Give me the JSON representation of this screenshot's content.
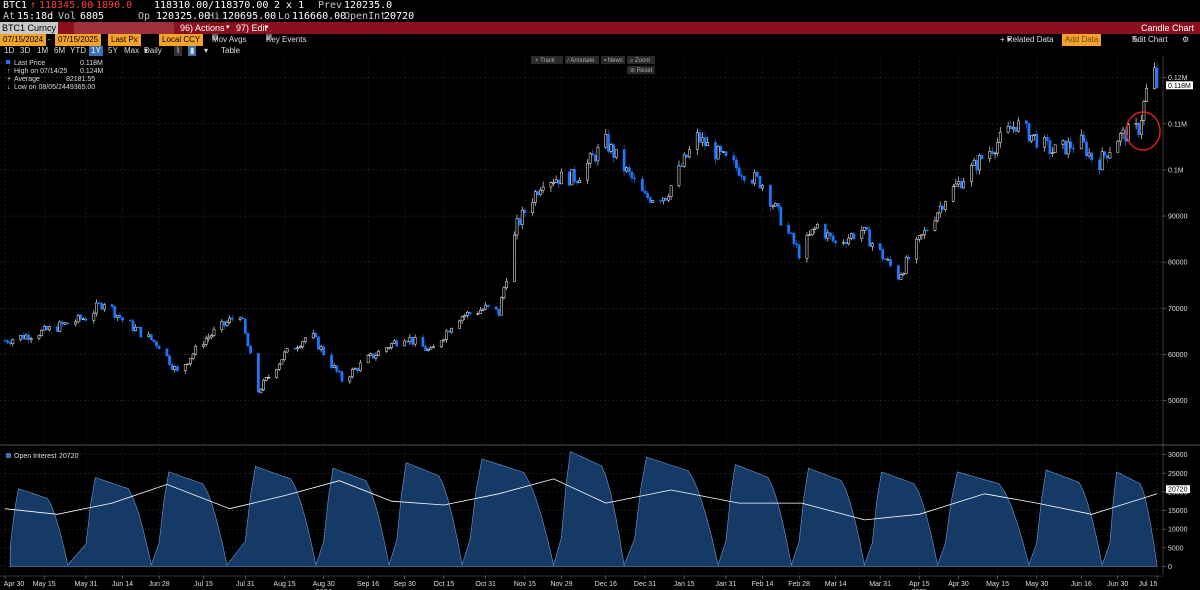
{
  "quote": {
    "ticker": "BTC1",
    "arrow": "↑",
    "last": "118345.00",
    "change": "-1890.0",
    "bid_ask": "118310.00/118370.00",
    "size": "2 x 1",
    "prev_label": "Prev",
    "prev": "120235.0",
    "at_label": "At",
    "time": "15:18d",
    "vol_label": "Vol",
    "vol": "6805",
    "op_label": "Op",
    "open": "120325.00",
    "hi_label": "Hi",
    "high": "120695.00",
    "lo_label": "Lo",
    "low": "116660.00",
    "oi_label": "OpenInt",
    "open_int": "20720"
  },
  "security_bar": {
    "security": "BTC1 Curncy",
    "actions_label": "96) Actions",
    "edit_label": "97) Edit",
    "title": "Candle Chart"
  },
  "toolbar": {
    "start_date": "07/15/2024",
    "end_date": "07/15/2025",
    "field": "Last Px",
    "currency": "Local CCY",
    "mov_avgs": "Mov Avgs",
    "key_events": "Key Events",
    "related_data": "Related Data",
    "add_data": "Add Data",
    "edit_chart": "Edit Chart"
  },
  "periods": {
    "items": [
      "1D",
      "3D",
      "1M",
      "6M",
      "YTD",
      "1Y",
      "5Y",
      "Max"
    ],
    "active": "1Y",
    "freq": "Daily",
    "table": "Table"
  },
  "chart_tools": [
    "Track",
    "Annotate",
    "News",
    "Zoom"
  ],
  "reset_label": "Reset",
  "legend": {
    "last_price_label": "Last Price",
    "last_price": "0.118M",
    "high_label": "High on 07/14/25",
    "high": "0.124M",
    "avg_label": "Average",
    "avg": "82181.55",
    "low_label": "Low on 08/05/24",
    "low": "49365.00",
    "oi_label": "Open Interest",
    "oi_value": "20720"
  },
  "colors": {
    "up": "#ffffff",
    "down": "#1e78ff",
    "oi_fill": "#163a66",
    "oi_line": "#ffffff",
    "annotation": "#e0202a"
  },
  "chart_data": [
    {
      "type": "candlestick",
      "title": "",
      "y_axis_labels": [
        "50000",
        "60000",
        "70000",
        "80000",
        "90000",
        "0.1M",
        "0.11M",
        "0.12M"
      ],
      "ylim": [
        41000,
        124700
      ],
      "x_tick_labels": [
        "Apr 30",
        "May 15",
        "May 31",
        "Jun 14",
        "Jun 28",
        "Jul 15",
        "Jul 31",
        "Aug 15",
        "Aug 30",
        "Sep 16",
        "Sep 30",
        "Oct 15",
        "Oct 31",
        "Nov 15",
        "Nov 29",
        "Dec 16",
        "Dec 31",
        "Jan 15",
        "Jan 31",
        "Feb 14",
        "Feb 28",
        "Mar 14",
        "Mar 31",
        "Apr 15",
        "Apr 30",
        "May 15",
        "May 30",
        "Jun 16",
        "Jun 30",
        "Jul 15"
      ],
      "year_labels": [
        "2024",
        "2025"
      ],
      "last_label": "0.118M",
      "price_path": [
        [
          "2024-04-30",
          63000
        ],
        [
          "2024-05-15",
          65000
        ],
        [
          "2024-05-31",
          68000
        ],
        [
          "2024-06-07",
          71500
        ],
        [
          "2024-06-14",
          67500
        ],
        [
          "2024-06-28",
          62000
        ],
        [
          "2024-07-05",
          56000
        ],
        [
          "2024-07-15",
          63000
        ],
        [
          "2024-07-29",
          69000
        ],
        [
          "2024-08-05",
          52000
        ],
        [
          "2024-08-15",
          60000
        ],
        [
          "2024-08-25",
          64500
        ],
        [
          "2024-09-06",
          54500
        ],
        [
          "2024-09-16",
          59000
        ],
        [
          "2024-09-30",
          64000
        ],
        [
          "2024-10-10",
          60500
        ],
        [
          "2024-10-20",
          68000
        ],
        [
          "2024-10-31",
          70000
        ],
        [
          "2024-11-05",
          69000
        ],
        [
          "2024-11-12",
          88000
        ],
        [
          "2024-11-22",
          98000
        ],
        [
          "2024-12-05",
          98500
        ],
        [
          "2024-12-16",
          106000
        ],
        [
          "2024-12-31",
          94000
        ],
        [
          "2025-01-08",
          94500
        ],
        [
          "2025-01-20",
          107000
        ],
        [
          "2025-01-31",
          102000
        ],
        [
          "2025-02-14",
          97000
        ],
        [
          "2025-02-25",
          85000
        ],
        [
          "2025-02-28",
          82000
        ],
        [
          "2025-03-07",
          88000
        ],
        [
          "2025-03-14",
          84000
        ],
        [
          "2025-03-24",
          87000
        ],
        [
          "2025-04-07",
          77000
        ],
        [
          "2025-04-15",
          84500
        ],
        [
          "2025-04-25",
          94000
        ],
        [
          "2025-05-08",
          102000
        ],
        [
          "2025-05-22",
          110000
        ],
        [
          "2025-06-05",
          104000
        ],
        [
          "2025-06-16",
          106000
        ],
        [
          "2025-06-22",
          101000
        ],
        [
          "2025-06-30",
          107000
        ],
        [
          "2025-07-08",
          109000
        ],
        [
          "2025-07-11",
          117000
        ],
        [
          "2025-07-14",
          121000
        ],
        [
          "2025-07-15",
          118345
        ]
      ]
    },
    {
      "type": "area",
      "title": "Open Interest",
      "y_axis_labels": [
        "0",
        "5000",
        "10000",
        "15000",
        "20000",
        "25000",
        "30000"
      ],
      "ylim": [
        -2000,
        31500
      ],
      "last_label": "20720",
      "cycles": [
        [
          "2024-05-02",
          "2024-05-24",
          21000
        ],
        [
          "2024-05-31",
          "2024-06-25",
          24000
        ],
        [
          "2024-06-28",
          "2024-07-24",
          25500
        ],
        [
          "2024-07-31",
          "2024-08-27",
          27000
        ],
        [
          "2024-08-30",
          "2024-09-24",
          26500
        ],
        [
          "2024-09-27",
          "2024-10-22",
          28000
        ],
        [
          "2024-10-25",
          "2024-11-26",
          29000
        ],
        [
          "2024-11-29",
          "2024-12-23",
          31000
        ],
        [
          "2024-12-27",
          "2025-01-28",
          29500
        ],
        [
          "2025-01-31",
          "2025-02-25",
          27500
        ],
        [
          "2025-02-28",
          "2025-03-25",
          26500
        ],
        [
          "2025-03-28",
          "2025-04-22",
          25500
        ],
        [
          "2025-04-25",
          "2025-05-27",
          25500
        ],
        [
          "2025-05-30",
          "2025-06-24",
          26000
        ],
        [
          "2025-06-27",
          "2025-07-15",
          25500
        ]
      ],
      "line_path": [
        [
          "2024-04-30",
          15500
        ],
        [
          "2024-05-20",
          14000
        ],
        [
          "2024-06-10",
          17000
        ],
        [
          "2024-07-01",
          22000
        ],
        [
          "2024-07-25",
          15500
        ],
        [
          "2024-08-15",
          19000
        ],
        [
          "2024-09-05",
          23000
        ],
        [
          "2024-09-25",
          17500
        ],
        [
          "2024-10-15",
          16500
        ],
        [
          "2024-11-05",
          19500
        ],
        [
          "2024-11-26",
          23500
        ],
        [
          "2024-12-16",
          17000
        ],
        [
          "2025-01-10",
          20500
        ],
        [
          "2025-02-05",
          17000
        ],
        [
          "2025-03-01",
          17000
        ],
        [
          "2025-03-25",
          12500
        ],
        [
          "2025-04-15",
          14000
        ],
        [
          "2025-05-10",
          19500
        ],
        [
          "2025-05-30",
          17000
        ],
        [
          "2025-06-20",
          14000
        ],
        [
          "2025-07-15",
          19500
        ]
      ]
    }
  ]
}
